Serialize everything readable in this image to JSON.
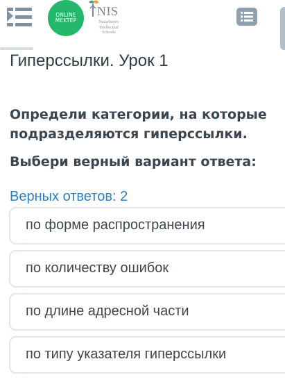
{
  "header": {
    "logo_online": "ONLINE",
    "logo_mektep": "MEKTEP",
    "nis_name": "NIS",
    "nis_line1": "Nazarbayev",
    "nis_line2": "Intellectual",
    "nis_line3": "Schools",
    "menu_icon": "hamburger-menu-icon",
    "list_icon": "list-icon"
  },
  "lesson": {
    "title": "Гиперсcылки. Урок 1"
  },
  "question": {
    "text": "Определи категории, на которые подразделяются гиперссылки.",
    "instruction": "Выбери верный вариант ответа:",
    "correct_count": "Верных ответов: 2"
  },
  "options": [
    {
      "label": "по форме распространения"
    },
    {
      "label": "по количеству ошибок"
    },
    {
      "label": "по длине адресной части"
    },
    {
      "label": "по типу указателя гиперссылки"
    }
  ],
  "colors": {
    "brand_green": "#24b86c",
    "accent_blue": "#2b7fc4",
    "icon_gray": "#8fa0b0"
  }
}
